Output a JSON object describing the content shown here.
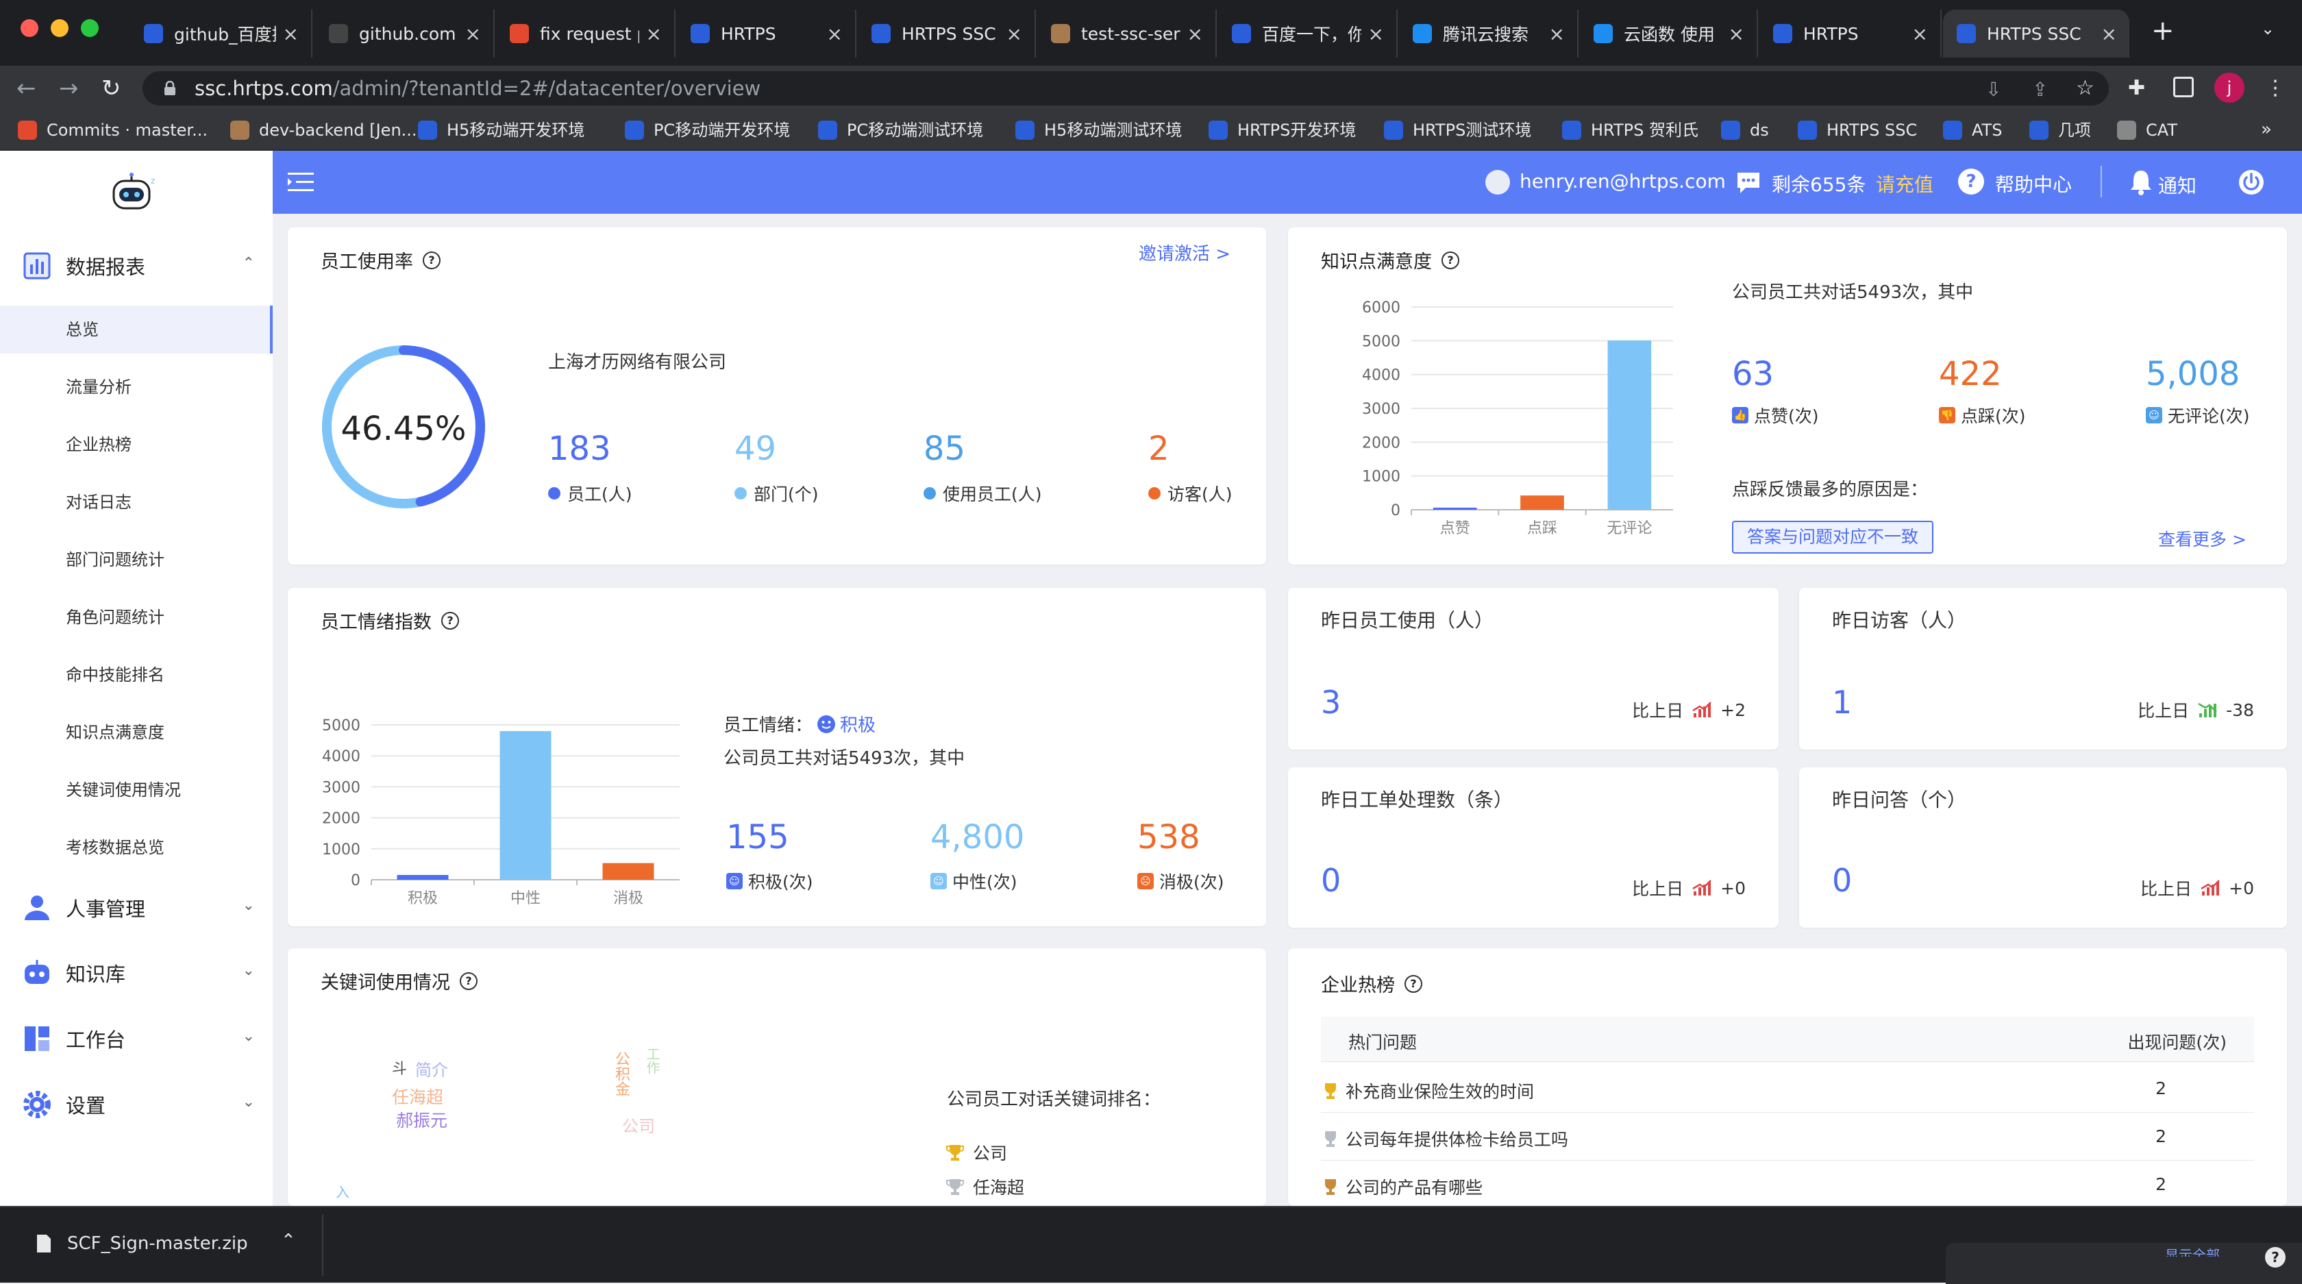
{
  "browser": {
    "tabs": [
      {
        "title": "github_百度搜索",
        "color": "#2b5fd9"
      },
      {
        "title": "github.com",
        "color": "#444"
      },
      {
        "title": "fix request p",
        "color": "#e2492f"
      },
      {
        "title": "HRTPS",
        "color": "#2b5fd9"
      },
      {
        "title": "HRTPS SSC",
        "color": "#2b5fd9"
      },
      {
        "title": "test-ssc-ser",
        "color": "#a77b4f"
      },
      {
        "title": "百度一下，你",
        "color": "#2b5fd9"
      },
      {
        "title": "腾讯云搜索",
        "color": "#1d8ef0"
      },
      {
        "title": "云函数 使用",
        "color": "#1d8ef0"
      },
      {
        "title": "HRTPS",
        "color": "#2b5fd9"
      },
      {
        "title": "HRTPS SSC",
        "color": "#2b5fd9"
      }
    ],
    "url_host": "ssc.hrtps.com",
    "url_path": "/admin/?tenantId=2#/datacenter/overview",
    "bookmarks": [
      "Commits · master...",
      "dev-backend [Jen...",
      "H5移动端开发环境",
      "PC移动端开发环境",
      "PC移动端测试环境",
      "H5移动端测试环境",
      "HRTPS开发环境",
      "HRTPS测试环境",
      "HRTPS 贺利氏",
      "ds",
      "HRTPS SSC",
      "ATS",
      "几项",
      "CAT"
    ],
    "profile_initial": "j"
  },
  "header": {
    "email": "henry.ren@hrtps.com",
    "remaining": "剩余655条",
    "recharge": "请充值",
    "help": "帮助中心",
    "notify": "通知"
  },
  "sidebar": {
    "groups": [
      {
        "label": "数据报表",
        "expanded": true
      },
      {
        "label": "人事管理"
      },
      {
        "label": "知识库"
      },
      {
        "label": "工作台"
      },
      {
        "label": "设置"
      }
    ],
    "items": [
      "总览",
      "流量分析",
      "企业热榜",
      "对话日志",
      "部门问题统计",
      "角色问题统计",
      "命中技能排名",
      "知识点满意度",
      "关键词使用情况",
      "考核数据总览"
    ]
  },
  "usage": {
    "title": "员工使用率",
    "invite": "邀请激活 >",
    "rate": "46.45%",
    "rate_value": 46.45,
    "company": "上海才历网络有限公司",
    "stats": [
      {
        "value": "183",
        "label": "员工(人)",
        "color": "#4e6ef2"
      },
      {
        "value": "49",
        "label": "部门(个)",
        "color": "#7ec4f7"
      },
      {
        "value": "85",
        "label": "使用员工(人)",
        "color": "#4b9ee8"
      },
      {
        "value": "2",
        "label": "访客(人)",
        "color": "#ee6a2a"
      }
    ]
  },
  "satisfaction": {
    "title": "知识点满意度",
    "summary": "公司员工共对话5493次，其中",
    "stats": [
      {
        "value": "63",
        "label": "点赞(次)",
        "color": "#4e6ef2"
      },
      {
        "value": "422",
        "label": "点踩(次)",
        "color": "#ee6a2a"
      },
      {
        "value": "5,008",
        "label": "无评论(次)",
        "color": "#4b9ee8"
      }
    ],
    "reason_title": "点踩反馈最多的原因是：",
    "reason_tag": "答案与问题对应不一致",
    "more": "查看更多 >"
  },
  "emotion": {
    "title": "员工情绪指数",
    "mood_label": "员工情绪：",
    "mood": "积极",
    "summary": "公司员工共对话5493次，其中",
    "stats": [
      {
        "value": "155",
        "label": "积极(次)",
        "color": "#4e6ef2"
      },
      {
        "value": "4,800",
        "label": "中性(次)",
        "color": "#7ec4f7"
      },
      {
        "value": "538",
        "label": "消极(次)",
        "color": "#ee6a2a"
      }
    ]
  },
  "daily": [
    {
      "title": "昨日员工使用（人）",
      "value": "3",
      "cmp": "比上日",
      "delta": "+2",
      "up": true
    },
    {
      "title": "昨日访客（人）",
      "value": "1",
      "cmp": "比上日",
      "delta": "-38",
      "up": false
    },
    {
      "title": "昨日工单处理数（条）",
      "value": "0",
      "cmp": "比上日",
      "delta": "+0",
      "up": true
    },
    {
      "title": "昨日问答（个）",
      "value": "0",
      "cmp": "比上日",
      "delta": "+0",
      "up": true
    }
  ],
  "keywords": {
    "title": "关键词使用情况",
    "summary": "公司员工对话关键词排名：",
    "cloud": [
      {
        "text": "简介",
        "color": "#aab6f0"
      },
      {
        "text": "任海超",
        "color": "#f4b38d"
      },
      {
        "text": "郝振元",
        "color": "#9b7ce0"
      },
      {
        "text": "公司",
        "color": "#f1c4cb"
      },
      {
        "text": "斗",
        "color": "#555"
      },
      {
        "text": "公积金",
        "color": "#f0a874"
      },
      {
        "text": "工作",
        "color": "#b8e0b0"
      }
    ],
    "rank": [
      "公司",
      "任海超"
    ]
  },
  "hot": {
    "title": "企业热榜",
    "col1": "热门问题",
    "col2": "出现问题(次)",
    "rows": [
      {
        "q": "补充商业保险生效的时间",
        "n": "2"
      },
      {
        "q": "公司每年提供体检卡给员工吗",
        "n": "2"
      },
      {
        "q": "公司的产品有哪些",
        "n": "2"
      }
    ]
  },
  "download": {
    "file": "SCF_Sign-master.zip",
    "show_all": "显示全部"
  },
  "chart_data": [
    {
      "type": "bar",
      "categories": [
        "点赞",
        "点踩",
        "无评论"
      ],
      "values": [
        63,
        422,
        5008
      ],
      "colors": [
        "#4e6ef2",
        "#ee6a2a",
        "#7ec4f7"
      ],
      "ylim": [
        0,
        6000
      ],
      "yticks": [
        0,
        1000,
        2000,
        3000,
        4000,
        5000,
        6000
      ],
      "grid": true
    },
    {
      "type": "bar",
      "categories": [
        "积极",
        "中性",
        "消极"
      ],
      "values": [
        155,
        4800,
        538
      ],
      "colors": [
        "#4e6ef2",
        "#7ec4f7",
        "#ee6a2a"
      ],
      "ylim": [
        0,
        5000
      ],
      "yticks": [
        0,
        1000,
        2000,
        3000,
        4000,
        5000
      ],
      "grid": true
    }
  ]
}
